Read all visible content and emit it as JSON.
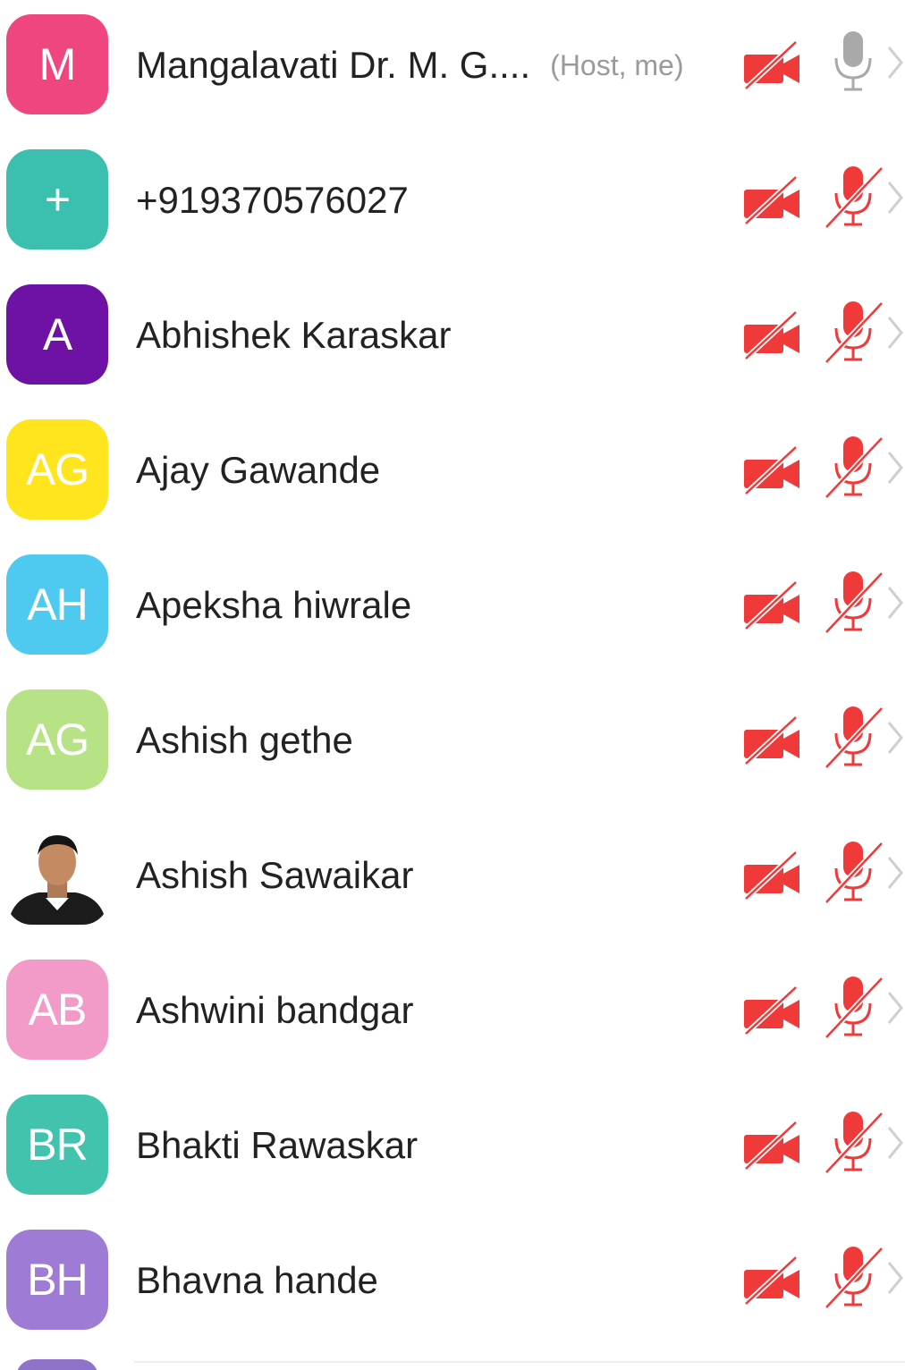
{
  "participants": [
    {
      "initials": "M",
      "name": "Mangalavati Dr. M. G....",
      "tag": "(Host, me)",
      "color": "#f0467f",
      "mic": "on",
      "camera": "off"
    },
    {
      "initials": "+",
      "name": "+919370576027",
      "tag": "",
      "color": "#3bbfae",
      "mic": "muted",
      "camera": "off"
    },
    {
      "initials": "A",
      "name": "Abhishek Karaskar",
      "tag": "",
      "color": "#6e12a6",
      "mic": "muted",
      "camera": "off"
    },
    {
      "initials": "AG",
      "name": "Ajay Gawande",
      "tag": "",
      "color": "#ffe51e",
      "mic": "muted",
      "camera": "off"
    },
    {
      "initials": "AH",
      "name": "Apeksha hiwrale",
      "tag": "",
      "color": "#4ecaf0",
      "mic": "muted",
      "camera": "off"
    },
    {
      "initials": "AG",
      "name": "Ashish gethe",
      "tag": "",
      "color": "#b7e285",
      "mic": "muted",
      "camera": "off"
    },
    {
      "initials": "",
      "name": "Ashish Sawaikar",
      "tag": "",
      "color": "#ffffff",
      "photo": true,
      "mic": "muted",
      "camera": "off"
    },
    {
      "initials": "AB",
      "name": "Ashwini bandgar",
      "tag": "",
      "color": "#f29bc9",
      "mic": "muted",
      "camera": "off"
    },
    {
      "initials": "BR",
      "name": "Bhakti Rawaskar",
      "tag": "",
      "color": "#42c3ae",
      "mic": "muted",
      "camera": "off"
    },
    {
      "initials": "BH",
      "name": "Bhavna hande",
      "tag": "",
      "color": "#9e7cd6",
      "mic": "muted",
      "camera": "off"
    }
  ],
  "icons": {
    "camera_off": "video-off-icon",
    "mic_on": "mic-icon",
    "mic_muted": "mic-muted-icon",
    "chevron": "chevron-right-icon"
  },
  "colors": {
    "muted_red": "#f03a3a",
    "mic_gray": "#a9a9a9",
    "chevron_gray": "#cfcfcf"
  }
}
